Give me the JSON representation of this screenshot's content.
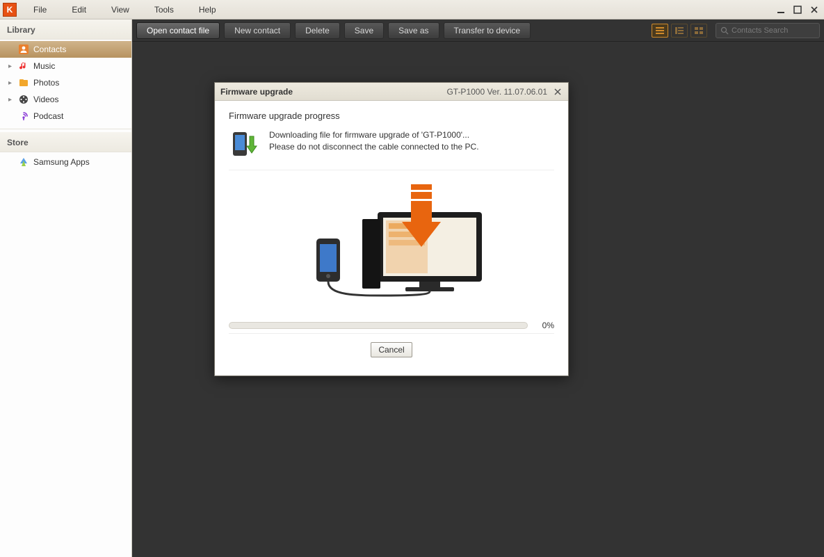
{
  "menu": {
    "file": "File",
    "edit": "Edit",
    "view": "View",
    "tools": "Tools",
    "help": "Help"
  },
  "sidebar": {
    "library_header": "Library",
    "store_header": "Store",
    "items": {
      "contacts": "Contacts",
      "music": "Music",
      "photos": "Photos",
      "videos": "Videos",
      "podcast": "Podcast",
      "samsung_apps": "Samsung Apps"
    }
  },
  "toolbar": {
    "open_contact": "Open contact file",
    "new_contact": "New contact",
    "delete": "Delete",
    "save": "Save",
    "save_as": "Save as",
    "transfer": "Transfer to device",
    "search_placeholder": "Contacts Search"
  },
  "modal": {
    "title": "Firmware upgrade",
    "version": "GT-P1000 Ver. 11.07.06.01",
    "subtitle": "Firmware upgrade progress",
    "line1": "Downloading file for firmware upgrade of 'GT-P1000'...",
    "line2": "Please do not disconnect the cable connected to the PC.",
    "percent": "0%",
    "cancel": "Cancel"
  }
}
